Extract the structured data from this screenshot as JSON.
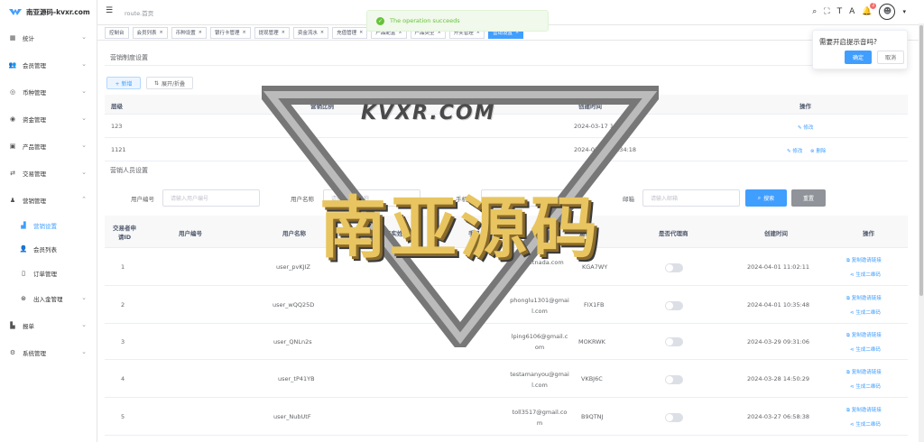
{
  "app": {
    "title": "南亚源码-kvxr.com"
  },
  "header": {
    "breadcrumb": "route.首页",
    "notif_count": "2"
  },
  "sidebar": {
    "items": [
      {
        "label": "统计"
      },
      {
        "label": "会员管理"
      },
      {
        "label": "币种管理"
      },
      {
        "label": "资金管理"
      },
      {
        "label": "产品管理"
      },
      {
        "label": "交易管理"
      },
      {
        "label": "营销管理"
      },
      {
        "label": "营销设置"
      },
      {
        "label": "会员列表"
      },
      {
        "label": "订单管理"
      },
      {
        "label": "出入金管理"
      },
      {
        "label": "报单"
      },
      {
        "label": "系统管理"
      }
    ]
  },
  "tabs": [
    "控制台",
    "会员列表",
    "币种设置",
    "银行卡管理",
    "提现管理",
    "资金流水",
    "充值管理",
    "产品配置",
    "产品类型",
    "开奖管理",
    "营销设置"
  ],
  "toast": {
    "text": "The operation succeeds"
  },
  "popup": {
    "title": "需要开启提示音吗?",
    "confirm": "确定",
    "cancel": "取消"
  },
  "marketing": {
    "title": "营销制度设置",
    "add": "+ 新增",
    "expand": "展开/折叠",
    "headers": [
      "层级",
      "营销比例",
      "创建时间",
      "操作"
    ],
    "rows": [
      {
        "level": "123",
        "time": "2024-03-17 18:34:29",
        "actions": [
          "修改"
        ]
      },
      {
        "level": "1121",
        "time": "2024-03-16 12:34:18",
        "actions": [
          "修改",
          "删除"
        ]
      }
    ]
  },
  "personnel": {
    "title": "营销人员设置",
    "filters": [
      {
        "label": "用户编号",
        "placeholder": "请输入用户编号"
      },
      {
        "label": "用户名称",
        "placeholder": "请输入用户名称"
      },
      {
        "label": "手机号",
        "placeholder": ""
      },
      {
        "label": "邮箱",
        "placeholder": "请输入邮箱"
      }
    ],
    "search": "搜索",
    "reset": "重置",
    "headers": [
      "交易者申请ID",
      "用户编号",
      "用户名称",
      "真实姓名",
      "手机号",
      "邮箱",
      "邀请码",
      "是否代理商",
      "创建时间",
      "操作"
    ],
    "rows": [
      {
        "id": "1",
        "user": "user_pvKJIZ",
        "email": "a@getnada.com",
        "code": "KGA7WY",
        "time": "2024-04-01 11:02:11"
      },
      {
        "id": "2",
        "user": "user_wQQ25D",
        "email": "phonglu1301@gmail.com",
        "code": "FIX1FB",
        "time": "2024-04-01 10:35:48"
      },
      {
        "id": "3",
        "user": "user_QNLn2s",
        "email": "lping6106@gmail.com",
        "code": "MOKRWK",
        "time": "2024-03-29 09:31:06"
      },
      {
        "id": "4",
        "user": "user_tP41YB",
        "email": "testamanyou@gmail.com",
        "code": "VKBJ6C",
        "time": "2024-03-28 14:50:29"
      },
      {
        "id": "5",
        "user": "user_NubUtF",
        "email": "toll3517@gmail.com",
        "code": "B9QTNJ",
        "time": "2024-03-27 06:58:38"
      }
    ],
    "row_actions": [
      "复制邀请链接",
      "生成二维码"
    ]
  },
  "watermark": {
    "top": "KVXR.COM",
    "main": "南亚源码"
  }
}
